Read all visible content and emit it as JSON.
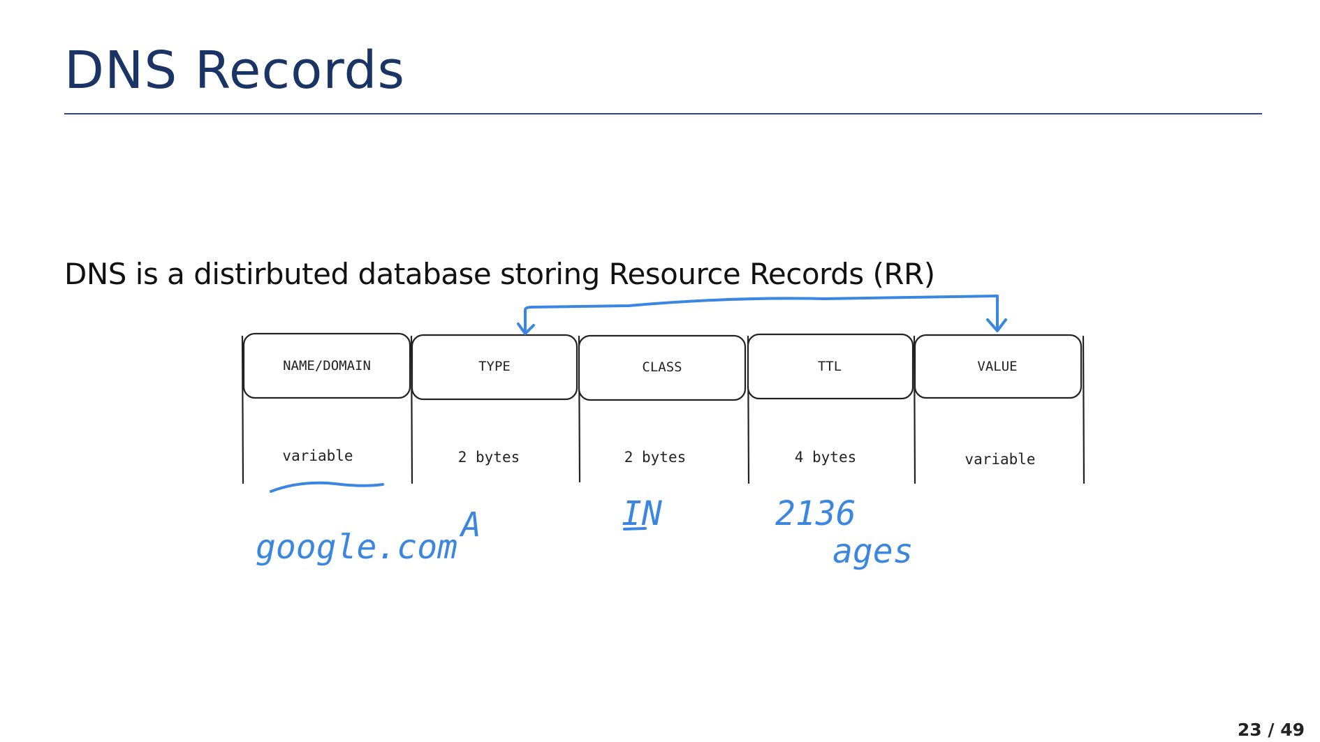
{
  "slide": {
    "title": "DNS Records",
    "body": "DNS is a distirbuted database storing Resource Records (RR)",
    "page_number": "23 / 49"
  },
  "diagram": {
    "fields": [
      {
        "header": "NAME/DOMAIN",
        "size": "variable"
      },
      {
        "header": "TYPE",
        "size": "2 bytes"
      },
      {
        "header": "CLASS",
        "size": "2 bytes"
      },
      {
        "header": "TTL",
        "size": "4 bytes"
      },
      {
        "header": "VALUE",
        "size": "variable"
      }
    ],
    "annotations": {
      "name_example": "google.com",
      "type_example": "A",
      "class_example": "IN",
      "ttl_example": "2136",
      "ttl_unit": "ages"
    }
  },
  "colors": {
    "title": "#1b3466",
    "rule": "#34497a",
    "ink": "#3a86e0",
    "sketch": "#222222"
  }
}
